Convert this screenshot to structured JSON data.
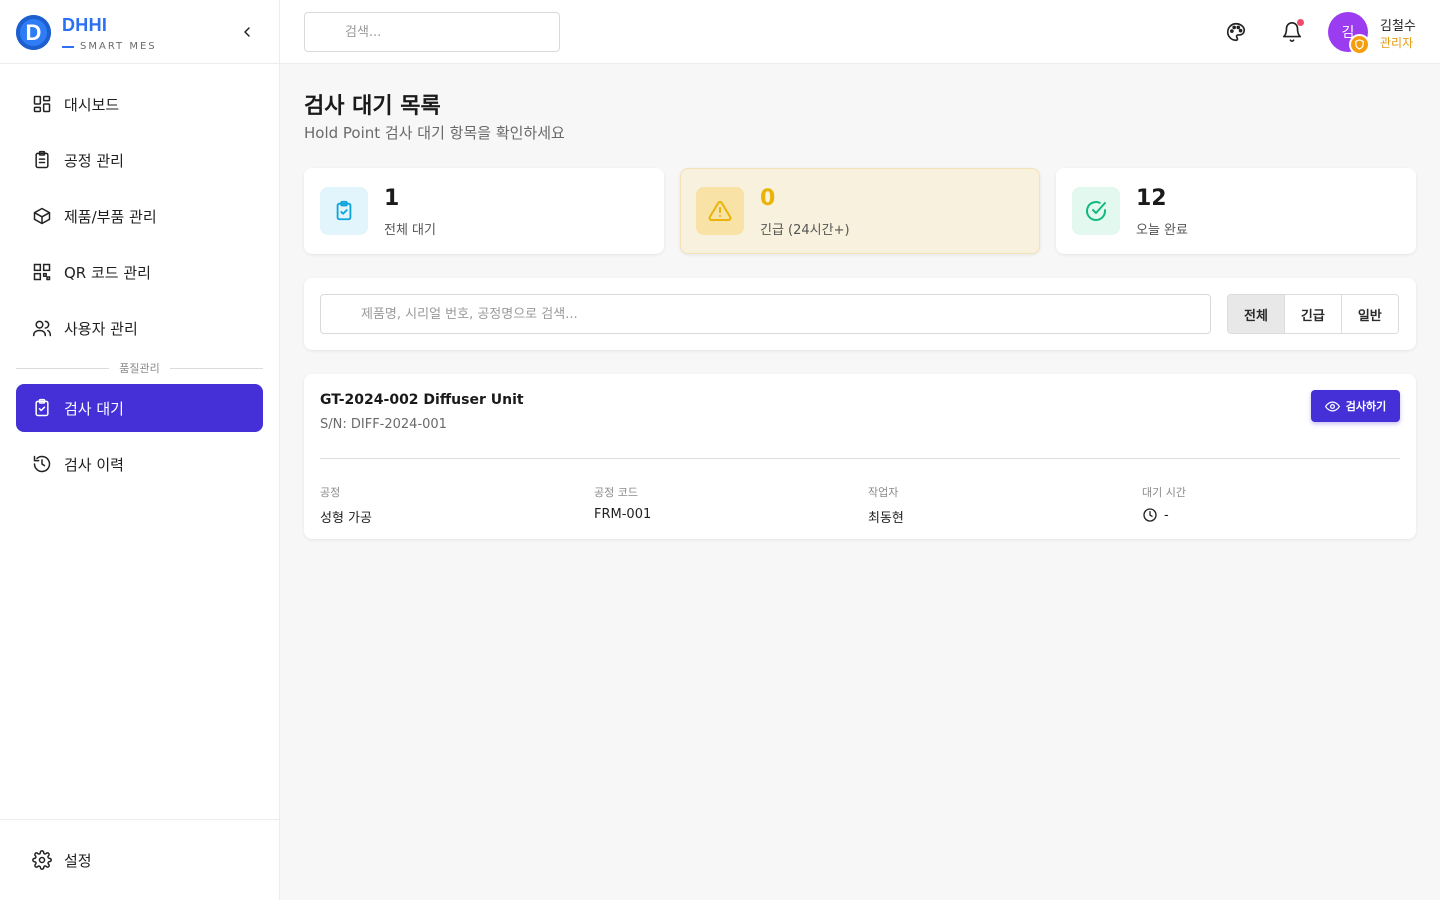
{
  "brand": {
    "logo_letter": "D",
    "name": "DHHI",
    "subtitle": "SMART MES",
    "color": "#2b6ff2"
  },
  "sidebar": {
    "items": [
      {
        "label": "대시보드",
        "icon": "dashboard-icon"
      },
      {
        "label": "공정 관리",
        "icon": "clipboard-icon"
      },
      {
        "label": "제품/부품 관리",
        "icon": "box-icon"
      },
      {
        "label": "QR 코드 관리",
        "icon": "qr-code-icon"
      },
      {
        "label": "사용자 관리",
        "icon": "users-icon"
      }
    ],
    "section_label": "품질관리",
    "quality_items": [
      {
        "label": "검사 대기",
        "icon": "clipboard-check-icon",
        "active": true
      },
      {
        "label": "검사 이력",
        "icon": "history-icon",
        "active": false
      }
    ],
    "settings_label": "설정",
    "active_color": "#4430d6"
  },
  "header": {
    "search_placeholder": "검색...",
    "user": {
      "avatar_initial": "김",
      "name": "김철수",
      "role": "관리자",
      "avatar_color": "#9b3cf0",
      "role_color": "#e59b14"
    }
  },
  "page": {
    "title": "검사 대기 목록",
    "subtitle": "Hold Point 검사 대기 항목을 확인하세요"
  },
  "stats": [
    {
      "value": "1",
      "label": "전체 대기",
      "icon": "clipboard-check-icon",
      "color": "#0ea5d8"
    },
    {
      "value": "0",
      "label": "긴급 (24시간+)",
      "icon": "alert-triangle-icon",
      "color": "#eab308"
    },
    {
      "value": "12",
      "label": "오늘 완료",
      "icon": "check-circle-icon",
      "color": "#10b981"
    }
  ],
  "filter": {
    "search_placeholder": "제품명, 시리얼 번호, 공정명으로 검색...",
    "tabs": [
      {
        "label": "전체",
        "active": true
      },
      {
        "label": "긴급",
        "active": false
      },
      {
        "label": "일반",
        "active": false
      }
    ]
  },
  "items": [
    {
      "title": "GT-2024-002 Diffuser Unit",
      "serial": "S/N: DIFF-2024-001",
      "button_label": "검사하기",
      "fields": [
        {
          "label": "공정",
          "value": "성형 가공"
        },
        {
          "label": "공정 코드",
          "value": "FRM-001"
        },
        {
          "label": "작업자",
          "value": "최동현"
        },
        {
          "label": "대기 시간",
          "value": "-"
        }
      ]
    }
  ]
}
